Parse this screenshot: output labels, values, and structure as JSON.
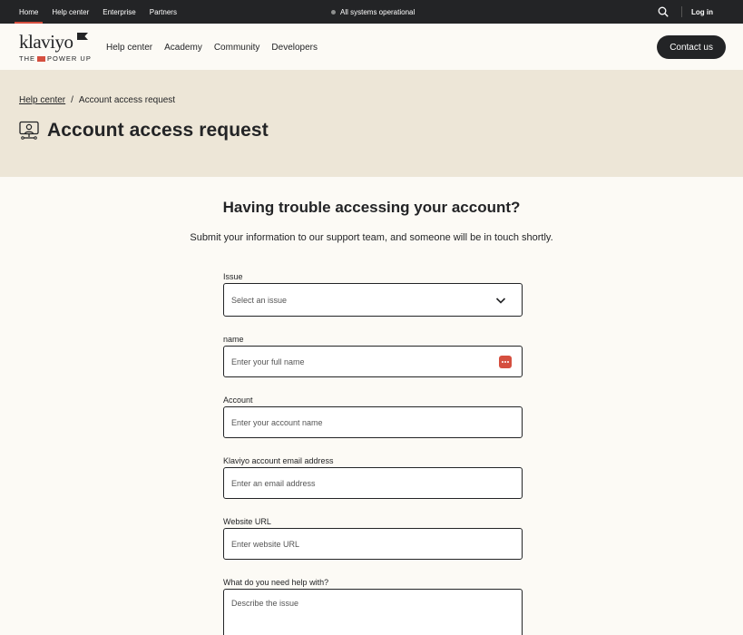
{
  "topbar": {
    "links": [
      "Home",
      "Help center",
      "Enterprise",
      "Partners"
    ],
    "status": "All systems operational",
    "login": "Log in"
  },
  "brand": {
    "wordmark": "klaviyo",
    "tagline_pre": "THE",
    "tagline_post": "POWER UP"
  },
  "nav": {
    "items": [
      "Help center",
      "Academy",
      "Community",
      "Developers"
    ],
    "contact": "Contact us"
  },
  "breadcrumb": {
    "parent": "Help center",
    "separator": "/",
    "current": "Account access request"
  },
  "page": {
    "title": "Account access request",
    "heading": "Having trouble accessing your account?",
    "subheading": "Submit your information to our support team, and someone will be in touch shortly."
  },
  "form": {
    "issue_label": "Issue",
    "issue_value": "Select an issue",
    "name_label": "name",
    "name_placeholder": "Enter your full name",
    "account_label": "Account",
    "account_placeholder": "Enter your account name",
    "email_label": "Klaviyo account email address",
    "email_placeholder": "Enter an email address",
    "website_label": "Website URL",
    "website_placeholder": "Enter website URL",
    "help_label": "What do you need help with?",
    "help_placeholder": "Describe the issue"
  },
  "colors": {
    "dark": "#232426",
    "accent": "#d54f3f",
    "hero_bg": "#ede6d7",
    "page_bg": "#fcfaf5"
  }
}
